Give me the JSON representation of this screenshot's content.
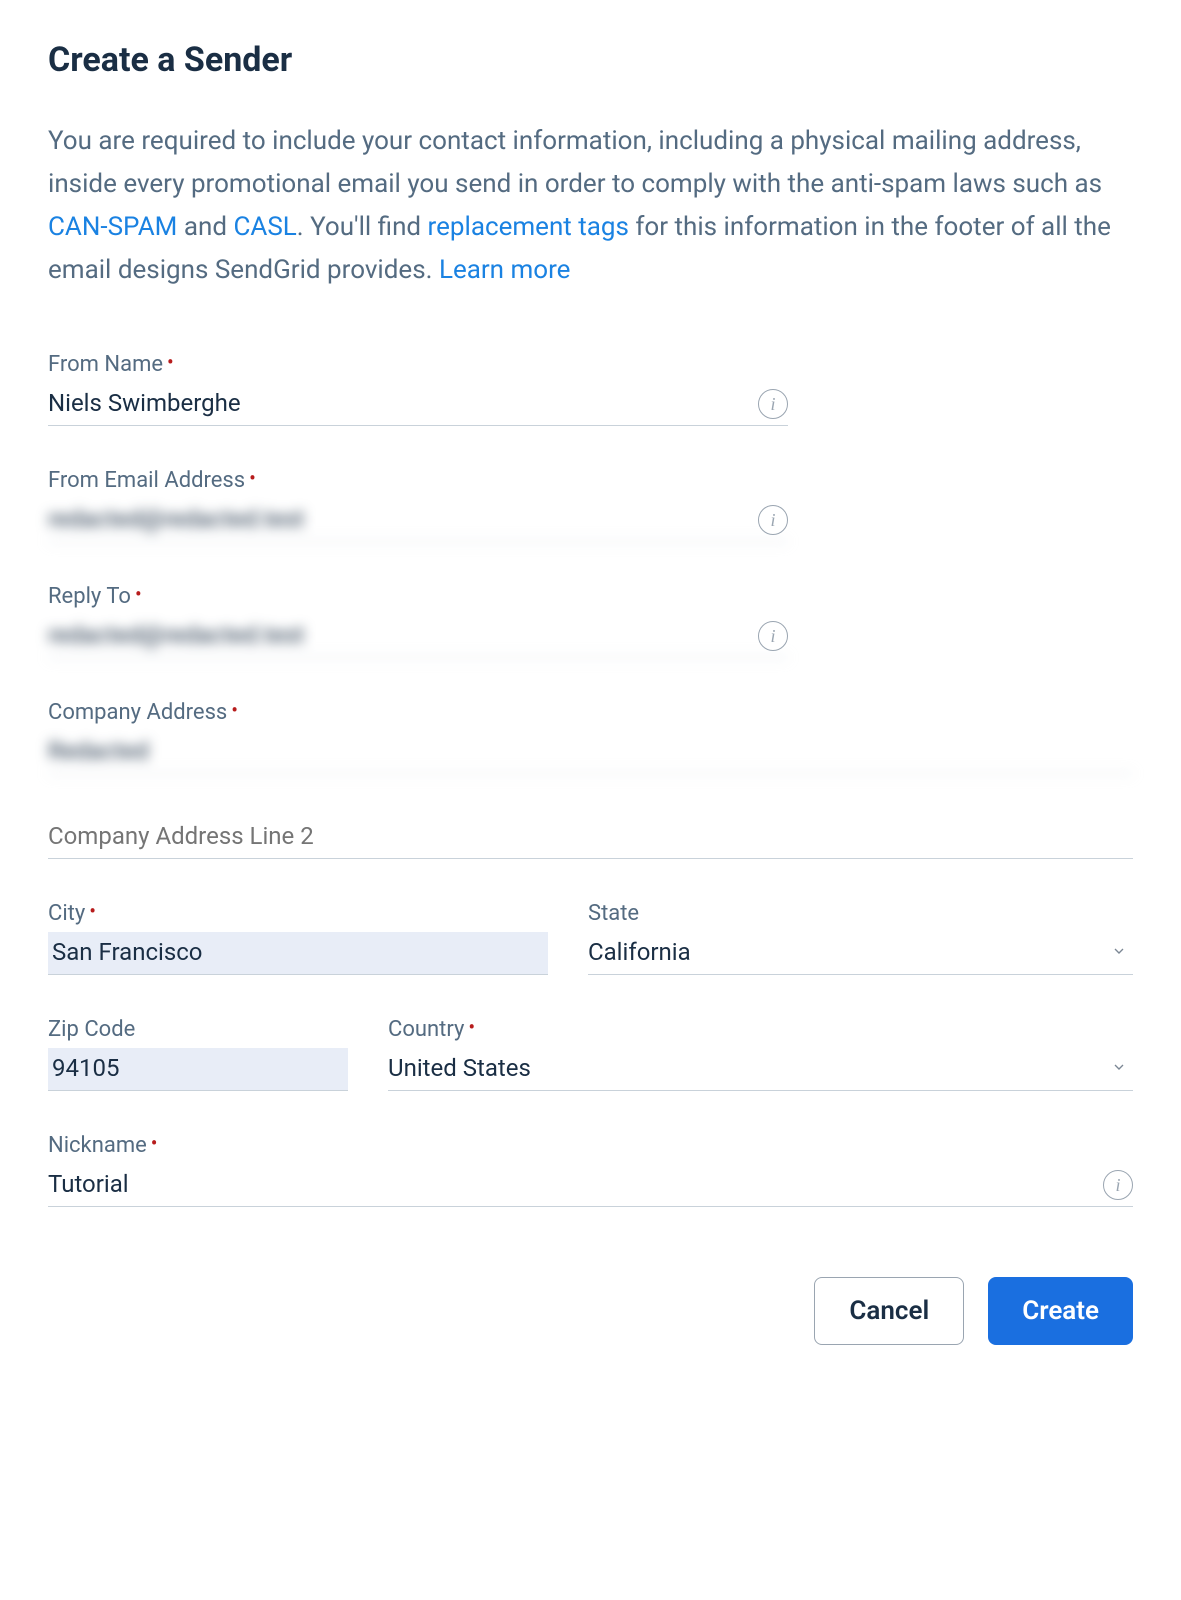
{
  "title": "Create a Sender",
  "description": {
    "part1": "You are required to include your contact information, including a physical mailing address, inside every promotional email you send in order to comply with the anti-spam laws such as ",
    "link_canspam": "CAN-SPAM",
    "part2": " and ",
    "link_casl": "CASL",
    "part3": ". You'll find ",
    "link_replacement": "replacement tags",
    "part4": " for this information in the footer of all the email designs SendGrid provides. ",
    "link_learn": "Learn more"
  },
  "fields": {
    "from_name": {
      "label": "From Name",
      "required": true,
      "value": "Niels Swimberghe",
      "has_info": true
    },
    "from_email": {
      "label": "From Email Address",
      "required": true,
      "value": "redacted@redacted.test",
      "has_info": true,
      "blurred": true
    },
    "reply_to": {
      "label": "Reply To",
      "required": true,
      "value": "redacted@redacted.test",
      "has_info": true,
      "blurred": true
    },
    "company_address": {
      "label": "Company Address",
      "required": true,
      "value": "Redacted",
      "blurred": true
    },
    "company_address2": {
      "label": "Company Address Line 2",
      "required": false,
      "value": ""
    },
    "city": {
      "label": "City",
      "required": true,
      "value": "San Francisco"
    },
    "state": {
      "label": "State",
      "required": false,
      "value": "California"
    },
    "zip": {
      "label": "Zip Code",
      "required": false,
      "value": "94105"
    },
    "country": {
      "label": "Country",
      "required": true,
      "value": "United States"
    },
    "nickname": {
      "label": "Nickname",
      "required": true,
      "value": "Tutorial",
      "has_info": true
    }
  },
  "actions": {
    "cancel": "Cancel",
    "create": "Create"
  }
}
